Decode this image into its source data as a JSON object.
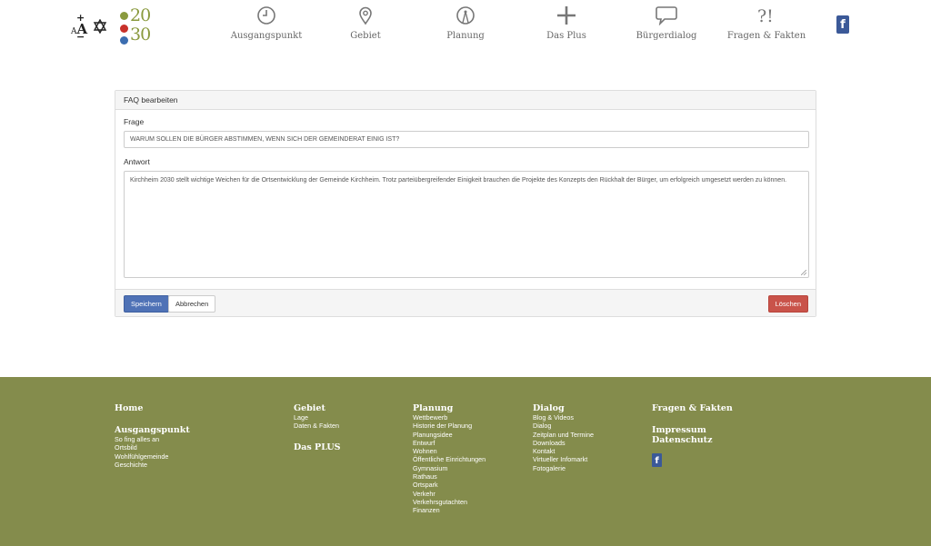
{
  "header": {
    "accessibility": {
      "font_size_icon": "font-size-icon",
      "contrast_icon": "contrast-icon"
    },
    "logo": {
      "line1": "20",
      "line2": "30",
      "colors": [
        "#8a9a3e",
        "#c8312a",
        "#3b6db0"
      ]
    },
    "nav": [
      {
        "label": "Ausgangspunkt",
        "icon": "clock-icon"
      },
      {
        "label": "Gebiet",
        "icon": "map-pin-icon"
      },
      {
        "label": "Planung",
        "icon": "compass-icon"
      },
      {
        "label": "Das Plus",
        "icon": "plus-icon"
      },
      {
        "label": "Bürgerdialog",
        "icon": "speech-bubble-icon"
      },
      {
        "label": "Fragen & Fakten",
        "icon": "question-exclamation-icon"
      }
    ],
    "facebook": {
      "letter": "f",
      "icon": "facebook-icon",
      "color": "#3b5998"
    }
  },
  "form": {
    "heading": "FAQ bearbeiten",
    "question_label": "Frage",
    "question_value": "WARUM SOLLEN DIE BÜRGER ABSTIMMEN, WENN SICH DER GEMEINDERAT EINIG IST?",
    "answer_label": "Antwort",
    "answer_value": "Kirchheim 2030 stellt wichtige Weichen für die Ortsentwicklung der Gemeinde Kirchheim. Trotz parteiübergreifender Einigkeit brauchen die Projekte des Konzepts den Rückhalt der Bürger, um erfolgreich umgesetzt werden zu können.",
    "save_label": "Speichern",
    "cancel_label": "Abbrechen",
    "delete_label": "Löschen",
    "colors": {
      "primary": "#4f72b6",
      "danger": "#c9534a"
    }
  },
  "footer": {
    "background": "#848c4c",
    "col1": {
      "home": "Home",
      "ausgangspunkt": "Ausgangspunkt",
      "links": [
        "So fing alles an",
        "Ortsbild",
        "Wohlfühlgemeinde",
        "Geschichte"
      ]
    },
    "col2": {
      "gebiet": "Gebiet",
      "links": [
        "Lage",
        "Daten & Fakten"
      ],
      "plus": "Das PLUS"
    },
    "col3": {
      "planung": "Planung",
      "links": [
        "Wettbewerb",
        "Historie der Planung",
        "Planungsidee",
        "Entwurf",
        "Wohnen",
        "Öffentliche Einrichtungen",
        "Gymnasium",
        "Rathaus",
        "Ortspark",
        "Verkehr",
        "Verkehrsgutachten",
        "Finanzen"
      ]
    },
    "col4": {
      "dialog": "Dialog",
      "links": [
        "Blog & Videos",
        "Dialog",
        "Zeitplan und Termine",
        "Downloads",
        "Kontakt",
        "Virtueller Infomarkt",
        "Fotogalerie"
      ]
    },
    "col5": {
      "fragen": "Fragen & Fakten",
      "impressum": "Impressum",
      "datenschutz": "Datenschutz",
      "facebook_letter": "f"
    }
  }
}
